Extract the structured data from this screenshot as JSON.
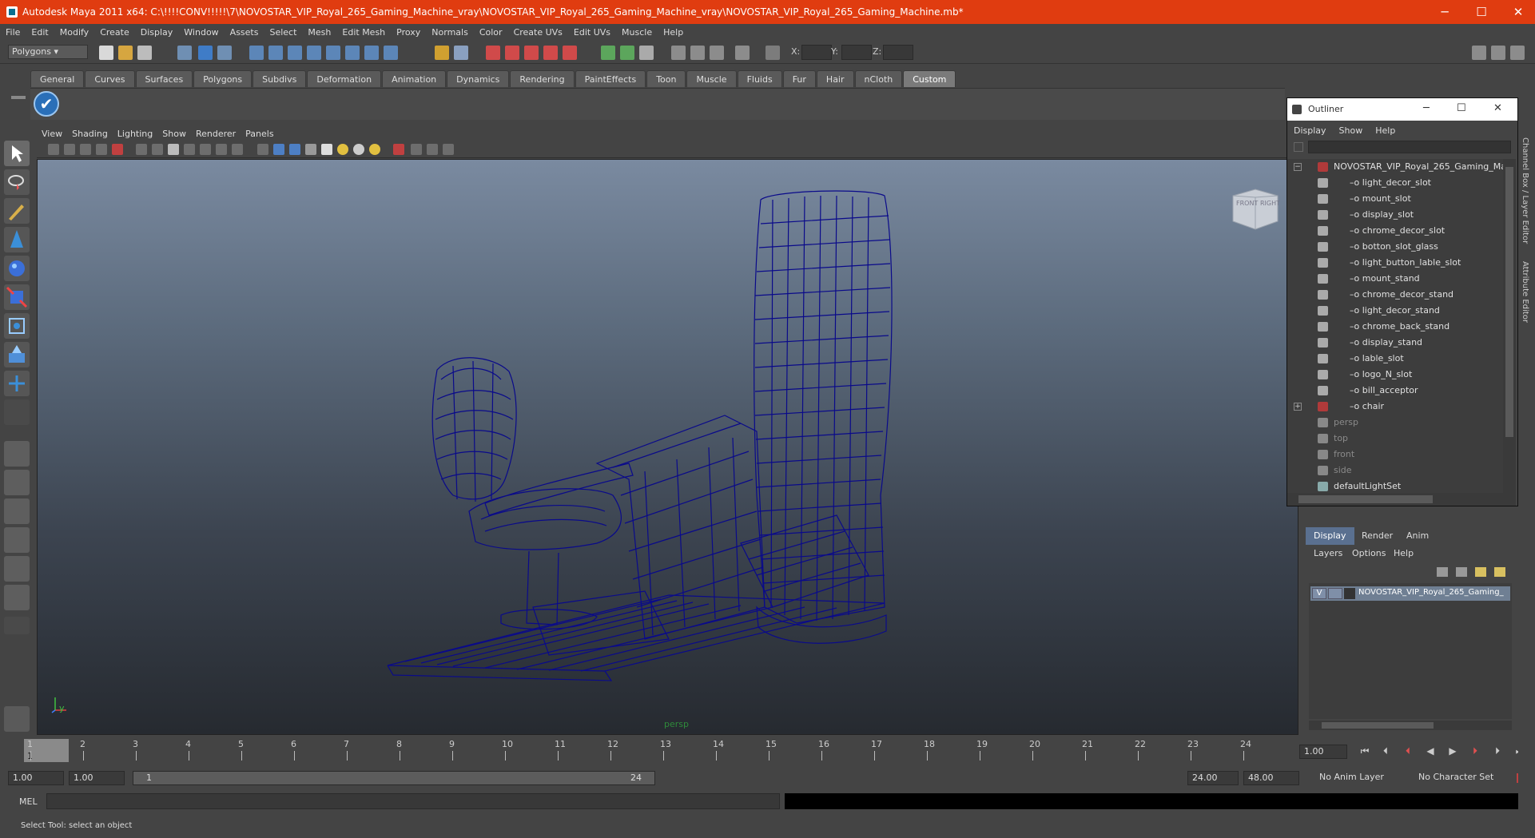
{
  "window": {
    "title": "Autodesk Maya 2011 x64: C:\\!!!!CONV!!!!!\\7\\NOVOSTAR_VIP_Royal_265_Gaming_Machine_vray\\NOVOSTAR_VIP_Royal_265_Gaming_Machine_vray\\NOVOSTAR_VIP_Royal_265_Gaming_Machine.mb*",
    "minimize": "─",
    "maximize": "☐",
    "close": "✕"
  },
  "menubar": [
    "File",
    "Edit",
    "Modify",
    "Create",
    "Display",
    "Window",
    "Assets",
    "Select",
    "Mesh",
    "Edit Mesh",
    "Proxy",
    "Normals",
    "Color",
    "Create UVs",
    "Edit UVs",
    "Muscle",
    "Help"
  ],
  "statusline": {
    "mode": "Polygons",
    "x_label": "X:",
    "y_label": "Y:",
    "z_label": "Z:"
  },
  "shelf_tabs": [
    "General",
    "Curves",
    "Surfaces",
    "Polygons",
    "Subdivs",
    "Deformation",
    "Animation",
    "Dynamics",
    "Rendering",
    "PaintEffects",
    "Toon",
    "Muscle",
    "Fluids",
    "Fur",
    "Hair",
    "nCloth",
    "Custom"
  ],
  "shelf_active": "Custom",
  "viewport": {
    "menu": [
      "View",
      "Shading",
      "Lighting",
      "Show",
      "Renderer",
      "Panels"
    ],
    "camera_label": "persp",
    "cube_front": "FRONT",
    "cube_right": "RIGHT",
    "axis_x": "x",
    "axis_y": "y"
  },
  "timeline": {
    "ticks": [
      "1",
      "2",
      "3",
      "4",
      "5",
      "6",
      "7",
      "8",
      "9",
      "10",
      "11",
      "12",
      "13",
      "14",
      "15",
      "16",
      "17",
      "18",
      "19",
      "20",
      "21",
      "22",
      "23",
      "24"
    ],
    "current_frame": "1.00",
    "current_marker": "1"
  },
  "range": {
    "start": "1.00",
    "start2": "1.00",
    "slider_start": "1",
    "slider_end": "24",
    "end": "24.00",
    "end2": "48.00",
    "anim_layer": "No Anim Layer",
    "char_set": "No Character Set"
  },
  "cmdline": {
    "label": "MEL"
  },
  "helpline": "Select Tool: select an object",
  "outliner": {
    "title": "Outliner",
    "menu": [
      "Display",
      "Show",
      "Help"
    ],
    "items": [
      {
        "label": "NOVOSTAR_VIP_Royal_265_Gaming_Ma",
        "kind": "root"
      },
      {
        "label": "light_decor_slot",
        "kind": "mesh"
      },
      {
        "label": "mount_slot",
        "kind": "mesh"
      },
      {
        "label": "display_slot",
        "kind": "mesh"
      },
      {
        "label": "chrome_decor_slot",
        "kind": "mesh"
      },
      {
        "label": "botton_slot_glass",
        "kind": "mesh"
      },
      {
        "label": "light_button_lable_slot",
        "kind": "mesh"
      },
      {
        "label": "mount_stand",
        "kind": "mesh"
      },
      {
        "label": "chrome_decor_stand",
        "kind": "mesh"
      },
      {
        "label": "light_decor_stand",
        "kind": "mesh"
      },
      {
        "label": "chrome_back_stand",
        "kind": "mesh"
      },
      {
        "label": "display_stand",
        "kind": "mesh"
      },
      {
        "label": "lable_slot",
        "kind": "mesh"
      },
      {
        "label": "logo_N_slot",
        "kind": "mesh"
      },
      {
        "label": "bill_acceptor",
        "kind": "mesh"
      },
      {
        "label": "chair",
        "kind": "group"
      },
      {
        "label": "persp",
        "kind": "camera"
      },
      {
        "label": "top",
        "kind": "camera"
      },
      {
        "label": "front",
        "kind": "camera"
      },
      {
        "label": "side",
        "kind": "camera"
      },
      {
        "label": "defaultLightSet",
        "kind": "set"
      }
    ]
  },
  "layer_editor": {
    "tabs": [
      "Display",
      "Render",
      "Anim"
    ],
    "active_tab": "Display",
    "menu": [
      "Layers",
      "Options",
      "Help"
    ],
    "layer_v": "V",
    "layer_name": "NOVOSTAR_VIP_Royal_265_Gaming_"
  },
  "right_strip": {
    "channel_box": "Channel Box / Layer Editor",
    "attr_editor": "Attribute Editor"
  },
  "colors": {
    "title_bar": "#e03c10",
    "wireframe": "#0a0a8a",
    "selected_layer": "#6f7f93"
  }
}
